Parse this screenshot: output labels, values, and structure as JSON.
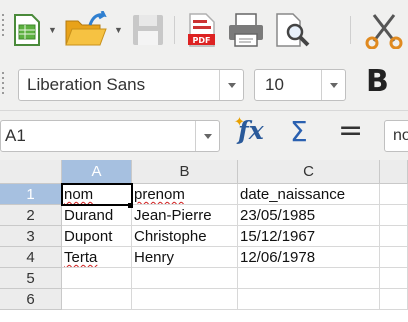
{
  "font_toolbar": {
    "font_name": "Liberation Sans",
    "font_size": "10",
    "bold_label": "B"
  },
  "formula_bar": {
    "name_box": "A1",
    "input_content": "nom"
  },
  "sheet": {
    "columns": [
      "A",
      "B",
      "C"
    ],
    "row_numbers": [
      "1",
      "2",
      "3",
      "4",
      "5",
      "6"
    ],
    "rows": [
      [
        "nom",
        "prenom",
        "date_naissance"
      ],
      [
        "Durand",
        "Jean-Pierre",
        "23/05/1985"
      ],
      [
        "Dupont",
        "Christophe",
        "15/12/1967"
      ],
      [
        "Terta",
        "Henry",
        "12/06/1978"
      ],
      [
        "",
        "",
        ""
      ],
      [
        "",
        "",
        ""
      ]
    ],
    "active_cell": "A1"
  },
  "icons": {
    "new": "new-spreadsheet-icon",
    "open": "open-folder-icon",
    "save": "save-icon",
    "pdf": "export-pdf-icon",
    "print": "print-icon",
    "preview": "print-preview-icon",
    "cut": "cut-icon",
    "function": "function-wizard-icon",
    "sum": "sum-icon",
    "formula": "formula-icon"
  },
  "colors": {
    "toolbar_bg": "#f0f0ef",
    "header_bg": "#ececec",
    "header_selected": "#a6c0e0",
    "spell_underline": "#d02020"
  }
}
